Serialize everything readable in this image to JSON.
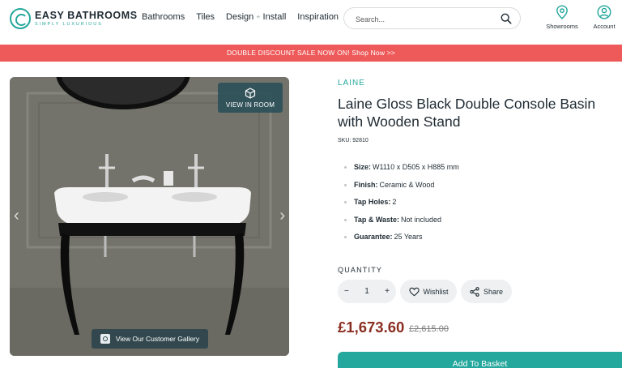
{
  "header": {
    "logo_name": "EASY BATHROOMS",
    "logo_tagline": "SIMPLY LUXURIOUS",
    "nav": {
      "bathrooms": "Bathrooms",
      "tiles": "Tiles",
      "design": "Design",
      "separator": "+",
      "install": "Install",
      "inspiration": "Inspiration"
    },
    "search_placeholder": "Search...",
    "showrooms_label": "Showrooms",
    "account_label": "Account"
  },
  "promo": {
    "text": "DOUBLE DISCOUNT SALE NOW ON! Shop Now >>"
  },
  "gallery": {
    "view_in_room_label": "VIEW IN ROOM",
    "customer_gallery_label": "View Our Customer Gallery",
    "prev_arrow": "‹",
    "next_arrow": "›"
  },
  "product": {
    "brand": "LAINE",
    "title": "Laine Gloss Black Double Console Basin with Wooden Stand",
    "sku": "SKU: 92810",
    "specs": [
      {
        "label": "Size:",
        "value": "W1110 x D505 x H885 mm"
      },
      {
        "label": "Finish:",
        "value": "Ceramic & Wood"
      },
      {
        "label": "Tap Holes:",
        "value": "2"
      },
      {
        "label": "Tap & Waste:",
        "value": "Not included"
      },
      {
        "label": "Guarantee:",
        "value": "25 Years"
      }
    ],
    "quantity_label": "QUANTITY",
    "quantity_minus": "−",
    "quantity_value": "1",
    "quantity_plus": "+",
    "wishlist_label": "Wishlist",
    "share_label": "Share",
    "price": "£1,673.60",
    "was_price": "£2,615.00",
    "add_to_basket_label": "Add To Basket"
  },
  "colors": {
    "accent": "#24a79c",
    "promo_bg": "#ee5a5a",
    "price": "#8b2e22"
  }
}
